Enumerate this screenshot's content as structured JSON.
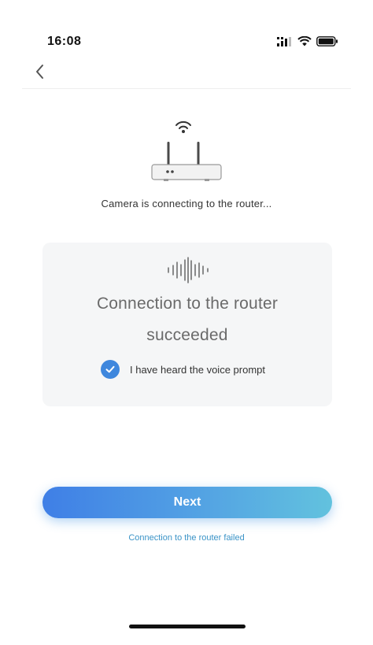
{
  "status_bar": {
    "time": "16:08",
    "icons": [
      "signal-icon",
      "wifi-icon",
      "battery-icon"
    ]
  },
  "nav": {
    "back_icon": "chevron-left-icon"
  },
  "illustration": {
    "icon": "router-icon",
    "wifi_icon": "wifi-icon"
  },
  "status_text": "Camera is connecting to the router...",
  "result_card": {
    "icon": "sound-wave-icon",
    "title_line1": "Connection to the router",
    "title_line2": "succeeded",
    "checkbox_checked": true,
    "checkbox_label": "I have heard the voice prompt"
  },
  "actions": {
    "next_label": "Next",
    "fail_link": "Connection to the router failed"
  },
  "colors": {
    "accent_blue": "#3f87dd",
    "gradient_start": "#3f7fe6",
    "gradient_end": "#62c2de",
    "link": "#3a93c7",
    "card_bg": "#f5f6f7"
  }
}
